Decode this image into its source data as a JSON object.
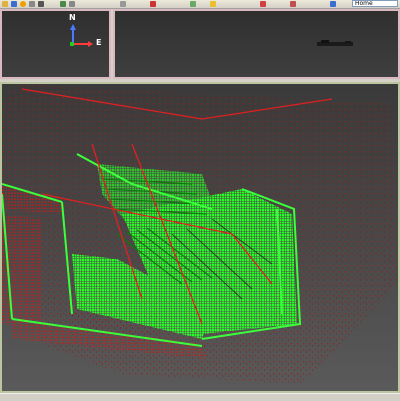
{
  "toolbar": {
    "search_value": "Home",
    "icons": [
      "open-icon",
      "save-icon",
      "color-icon",
      "view-icon",
      "tool-icon",
      "filter-icon",
      "segment-icon",
      "settings-icon",
      "paint-icon",
      "layers-icon",
      "info-icon",
      "plugin-icon",
      "measure-icon",
      "export-icon"
    ]
  },
  "overview": {
    "axis_north": "N",
    "axis_east": "E"
  },
  "colors": {
    "viewport_bg": "#404040",
    "point_green": "#22ff22",
    "point_red": "#cc1111"
  }
}
